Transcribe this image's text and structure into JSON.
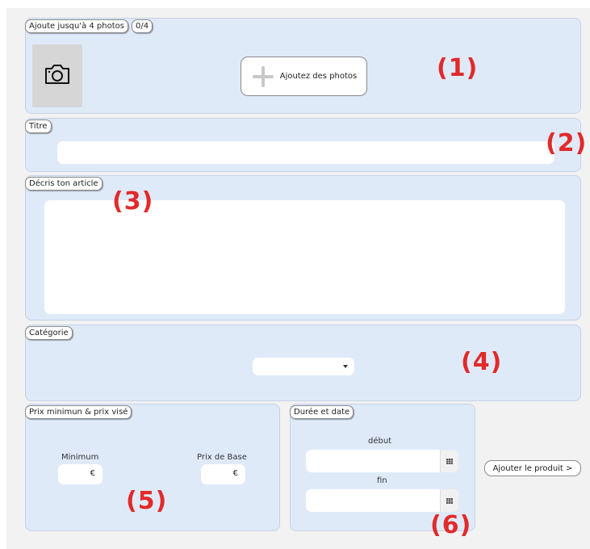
{
  "photos": {
    "label": "Ajoute jusqu'à 4 photos",
    "count": "0/4",
    "add_button": "Ajoutez des photos",
    "icon_camera": "camera-icon",
    "icon_plus": "plus-icon",
    "marker": "(1)"
  },
  "title": {
    "label": "Titre",
    "value": "",
    "marker": "(2)"
  },
  "description": {
    "label": "Décris ton article",
    "value": "",
    "marker": "(3)"
  },
  "category": {
    "label": "Catégorie",
    "selected": "",
    "marker": "(4)"
  },
  "price": {
    "label": "Prix minimun & prix visé",
    "min_label": "Minimum",
    "min_currency": "€",
    "base_label": "Prix de Base",
    "base_currency": "€",
    "marker": "(5)"
  },
  "duration": {
    "label": "Durée et date",
    "start_label": "début",
    "end_label": "fin",
    "calendar_icon": "calendar-icon",
    "marker": "(6)"
  },
  "submit": {
    "label": "Ajouter le produit >"
  },
  "colors": {
    "panel": "#dfeaf9",
    "marker": "#e12a2a"
  }
}
